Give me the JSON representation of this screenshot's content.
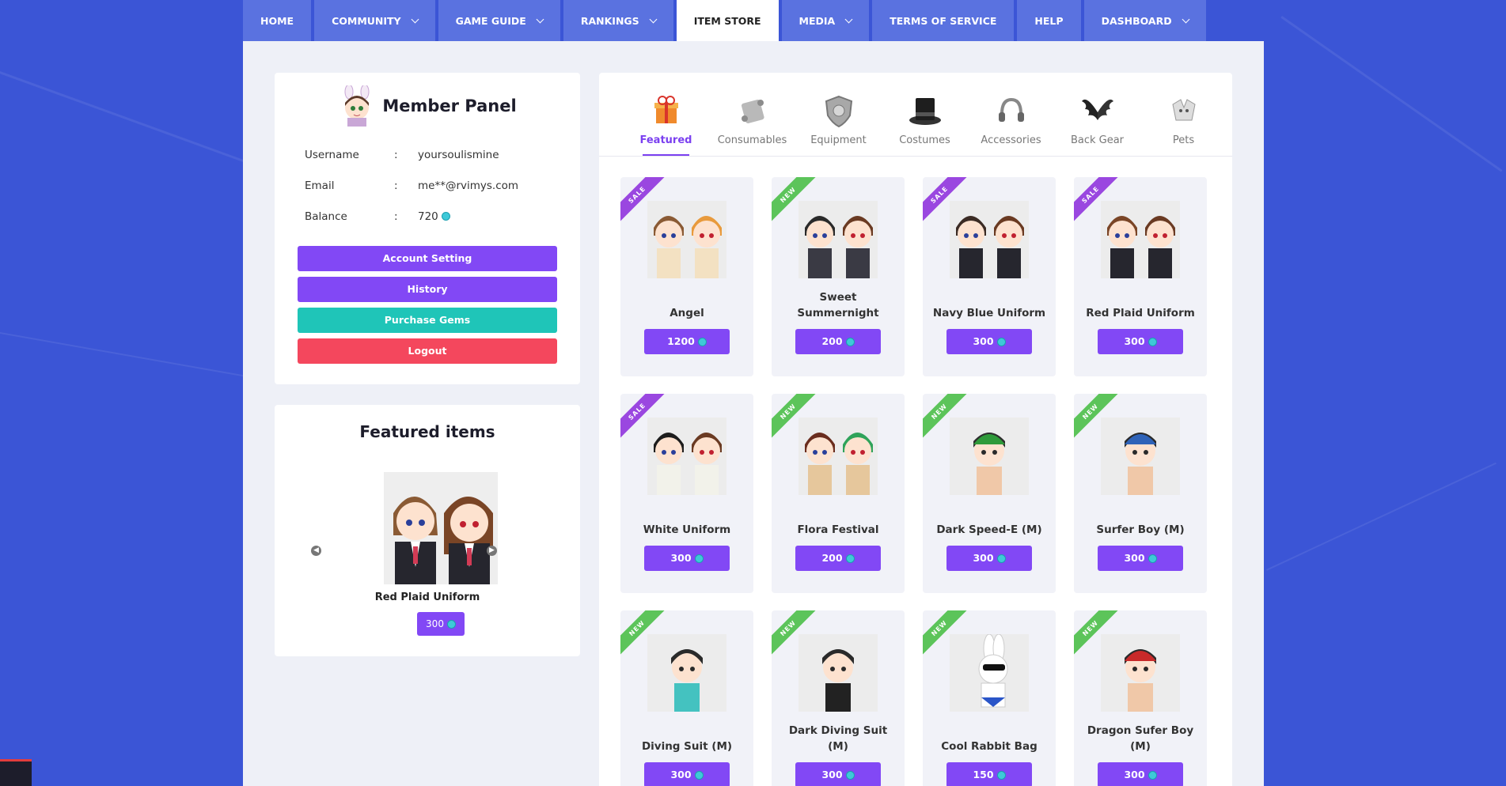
{
  "nav": [
    {
      "label": "HOME",
      "dropdown": false,
      "active": false
    },
    {
      "label": "COMMUNITY",
      "dropdown": true,
      "active": false
    },
    {
      "label": "GAME GUIDE",
      "dropdown": true,
      "active": false
    },
    {
      "label": "RANKINGS",
      "dropdown": true,
      "active": false
    },
    {
      "label": "ITEM STORE",
      "dropdown": false,
      "active": true
    },
    {
      "label": "MEDIA",
      "dropdown": true,
      "active": false
    },
    {
      "label": "TERMS OF SERVICE",
      "dropdown": false,
      "active": false
    },
    {
      "label": "HELP",
      "dropdown": false,
      "active": false
    },
    {
      "label": "DASHBOARD",
      "dropdown": true,
      "active": false
    }
  ],
  "member_panel": {
    "title": "Member Panel",
    "username_label": "Username",
    "username": "yoursoulismine",
    "email_label": "Email",
    "email": "me**@rvimys.com",
    "balance_label": "Balance",
    "balance": "720",
    "separator": ":",
    "buttons": {
      "account_setting": "Account Setting",
      "history": "History",
      "purchase_gems": "Purchase Gems",
      "logout": "Logout"
    }
  },
  "featured": {
    "title": "Featured items",
    "item_name": "Red Plaid Uniform",
    "price": "300"
  },
  "categories": [
    {
      "label": "Featured",
      "icon": "gift-icon",
      "active": true
    },
    {
      "label": "Consumables",
      "icon": "scroll-icon",
      "active": false
    },
    {
      "label": "Equipment",
      "icon": "shield-icon",
      "active": false
    },
    {
      "label": "Costumes",
      "icon": "top-hat-icon",
      "active": false
    },
    {
      "label": "Accessories",
      "icon": "headphones-icon",
      "active": false
    },
    {
      "label": "Back Gear",
      "icon": "wings-icon",
      "active": false
    },
    {
      "label": "Pets",
      "icon": "pet-icon",
      "active": false
    }
  ],
  "items": [
    {
      "name": "Angel",
      "price": "1200",
      "tag": "SALE"
    },
    {
      "name": "Sweet Summernight",
      "price": "200",
      "tag": "NEW"
    },
    {
      "name": "Navy Blue Uniform",
      "price": "300",
      "tag": "SALE"
    },
    {
      "name": "Red Plaid Uniform",
      "price": "300",
      "tag": "SALE"
    },
    {
      "name": "White Uniform",
      "price": "300",
      "tag": "SALE"
    },
    {
      "name": "Flora Festival",
      "price": "200",
      "tag": "NEW"
    },
    {
      "name": "Dark Speed-E (M)",
      "price": "300",
      "tag": "NEW"
    },
    {
      "name": "Surfer Boy (M)",
      "price": "300",
      "tag": "NEW"
    },
    {
      "name": "Diving Suit (M)",
      "price": "300",
      "tag": "NEW"
    },
    {
      "name": "Dark Diving Suit (M)",
      "price": "300",
      "tag": "NEW"
    },
    {
      "name": "Cool Rabbit Bag",
      "price": "150",
      "tag": "NEW"
    },
    {
      "name": "Dragon Sufer Boy (M)",
      "price": "300",
      "tag": "NEW"
    }
  ],
  "colors": {
    "background": "#3b55d6",
    "accent": "#8248f5",
    "teal": "#1fc5b8",
    "danger": "#f4475d",
    "sale": "#9a47e0",
    "new": "#5cc45a"
  }
}
